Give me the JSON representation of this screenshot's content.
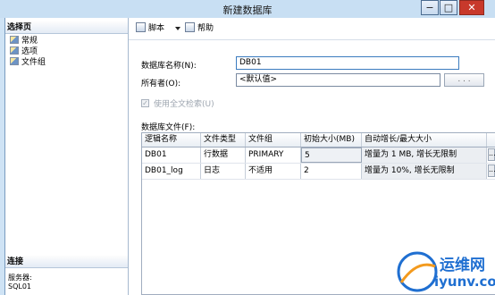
{
  "window": {
    "title": "新建数据库",
    "buttons": {
      "minimize": "−",
      "maximize": "□",
      "close": "✕"
    }
  },
  "left_pane": {
    "select_page_header": "选择页",
    "pages": [
      {
        "label": "常规",
        "icon": "page-icon"
      },
      {
        "label": "选项",
        "icon": "page-icon"
      },
      {
        "label": "文件组",
        "icon": "page-icon"
      }
    ],
    "connection_header": "连接",
    "server_label": "服务器:",
    "server_value": "SQL01"
  },
  "toolbar": {
    "script_label": "脚本",
    "script_icon": "script-icon",
    "help_label": "帮助",
    "help_icon": "help-icon"
  },
  "form": {
    "db_name_label": "数据库名称(N):",
    "db_name_value": "DB01",
    "owner_label": "所有者(O):",
    "owner_value": "<默认值>",
    "owner_browse": ". . .",
    "fulltext_label": "使用全文检索(U)",
    "fulltext_checked": true,
    "files_label": "数据库文件(F):"
  },
  "files_table": {
    "headers": [
      "逻辑名称",
      "文件类型",
      "文件组",
      "初始大小(MB)",
      "自动增长/最大大小"
    ],
    "rows": [
      {
        "logical_name": "DB01",
        "file_type": "行数据",
        "filegroup": "PRIMARY",
        "initial_size": "5",
        "autogrowth": "增量为 1 MB, 增长无限制",
        "autogrowth_button": "..."
      },
      {
        "logical_name": "DB01_log",
        "file_type": "日志",
        "filegroup": "不适用",
        "initial_size": "2",
        "autogrowth": "增量为 10%, 增长无限制",
        "autogrowth_button": "..."
      }
    ]
  },
  "watermark": {
    "brand_cn": "运维网",
    "brand_en": "iyunv.com"
  },
  "colors": {
    "title_bar": "#c8dff3",
    "close_button": "#c8392b",
    "watermark_blue": "#1f6fd1",
    "watermark_orange": "#f39a1e"
  }
}
